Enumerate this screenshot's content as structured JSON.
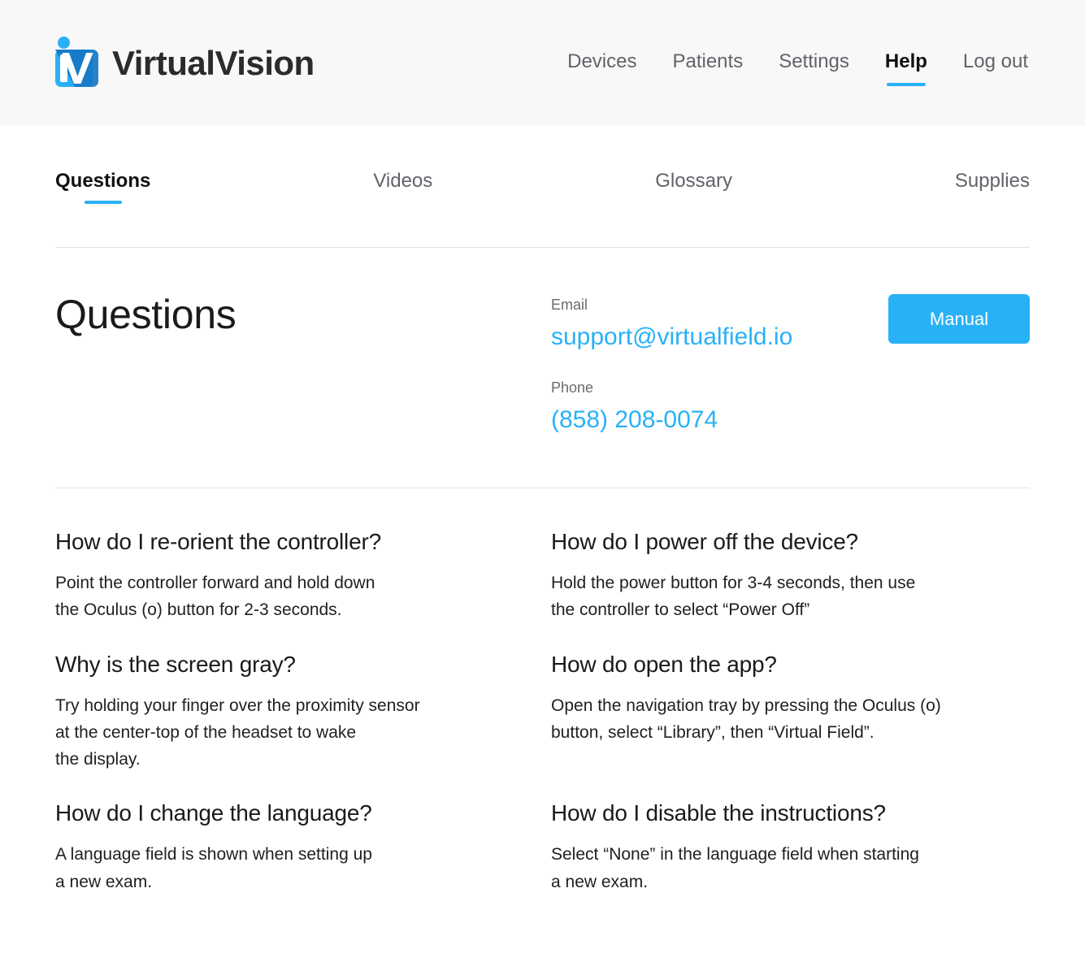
{
  "brand": {
    "name_part1": "Virtual",
    "name_part2": "Vision",
    "logo_icon": "virtualvision-logo-icon",
    "colors": {
      "light_blue": "#29b1f7",
      "dark_blue": "#1577c4"
    }
  },
  "nav": {
    "items": [
      {
        "label": "Devices",
        "active": false
      },
      {
        "label": "Patients",
        "active": false
      },
      {
        "label": "Settings",
        "active": false
      },
      {
        "label": "Help",
        "active": true
      },
      {
        "label": "Log out",
        "active": false
      }
    ]
  },
  "tabs": [
    {
      "label": "Questions",
      "active": true
    },
    {
      "label": "Videos",
      "active": false
    },
    {
      "label": "Glossary",
      "active": false
    },
    {
      "label": "Supplies",
      "active": false
    }
  ],
  "page": {
    "title": "Questions",
    "accent_color": "#29b1f7"
  },
  "contact": {
    "email_label": "Email",
    "email_value": "support@virtualfield.io",
    "phone_label": "Phone",
    "phone_value": "(858) 208-0074"
  },
  "actions": {
    "manual_label": "Manual"
  },
  "faqs": [
    {
      "question": "How do I re-orient the controller?",
      "answer": "Point the controller forward and hold down\nthe Oculus (o) button for 2-3 seconds."
    },
    {
      "question": "How do I power off the device?",
      "answer": "Hold the power button for 3-4 seconds, then use\nthe controller to select “Power Off”"
    },
    {
      "question": "Why is the screen gray?",
      "answer": "Try holding your finger over the proximity sensor\nat the center-top of the headset to wake\nthe display."
    },
    {
      "question": "How do open the app?",
      "answer": "Open the navigation tray by pressing the Oculus (o)\nbutton, select “Library”, then “Virtual Field”."
    },
    {
      "question": "How do I change the language?",
      "answer": "A language field is shown when setting up\na new exam."
    },
    {
      "question": "How do I disable the instructions?",
      "answer": "Select “None” in the language field when starting\na new exam."
    }
  ]
}
